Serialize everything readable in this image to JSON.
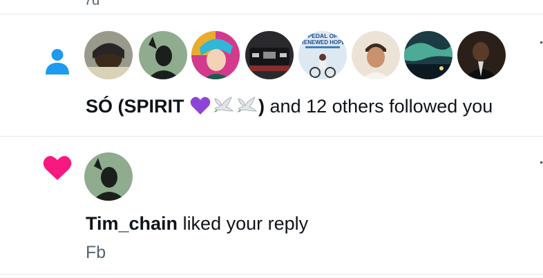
{
  "top_fragment": "7d",
  "colors": {
    "follow_icon": "#1d9bf0",
    "like_icon": "#f91880",
    "secondary_text": "#536471",
    "divider": "#e2e6ea"
  },
  "follow_notification": {
    "icon": "person-icon",
    "avatars": [
      {
        "name": "avatar-1",
        "label": ""
      },
      {
        "name": "avatar-2",
        "label": ""
      },
      {
        "name": "avatar-3",
        "label": ""
      },
      {
        "name": "avatar-4",
        "label": ""
      },
      {
        "name": "avatar-5",
        "label": "PEDAL OF RENEWED HOPE"
      },
      {
        "name": "avatar-6",
        "label": ""
      },
      {
        "name": "avatar-7",
        "label": ""
      },
      {
        "name": "avatar-8",
        "label": ""
      }
    ],
    "actor_name": "SÓ (SPIRIT",
    "actor_name_end": ")",
    "emojis": [
      "purple-heart-icon",
      "dove-icon",
      "dove-icon"
    ],
    "rest": " and 12 others followed you"
  },
  "like_notification": {
    "icon": "heart-icon",
    "actor_name": "Tim_chain",
    "action": " liked your reply",
    "reply_text": "Fb"
  }
}
